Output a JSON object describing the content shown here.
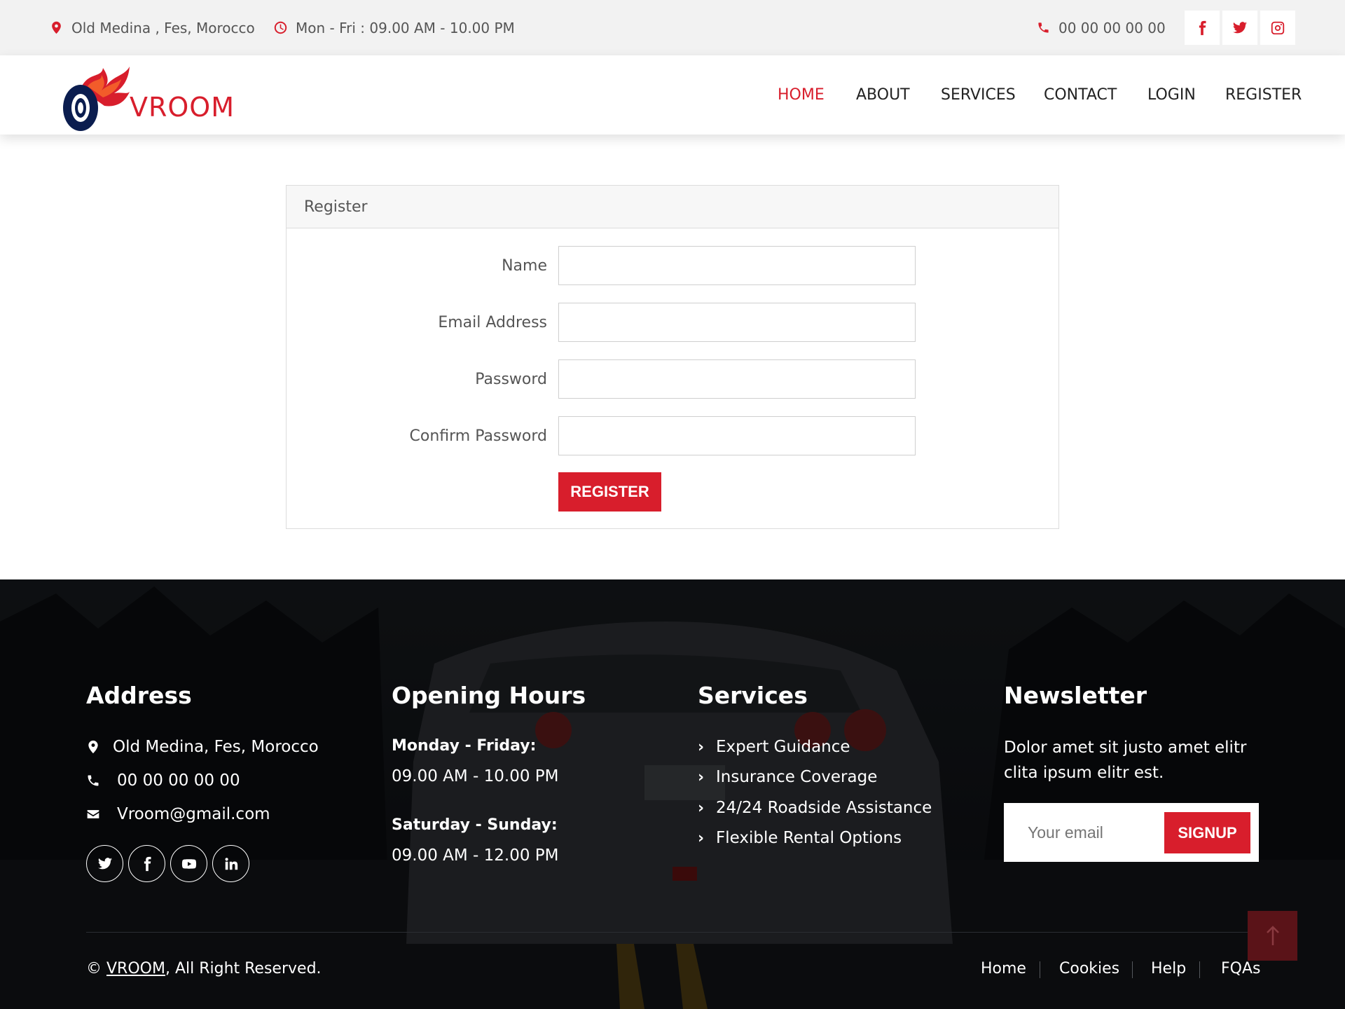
{
  "topbar": {
    "location": "Old Medina , Fes, Morocco",
    "hours": "Mon - Fri : 09.00 AM - 10.00 PM",
    "phone": "00 00 00 00 00",
    "social_icons": [
      "facebook-icon",
      "twitter-icon",
      "instagram-icon"
    ]
  },
  "brand": {
    "name": "VROOM",
    "accent_color": "#d81e2c",
    "dark_color": "#0b1d4f"
  },
  "nav": {
    "items": [
      {
        "label": "HOME",
        "active": true
      },
      {
        "label": "ABOUT",
        "active": false
      },
      {
        "label": "SERVICES",
        "active": false
      },
      {
        "label": "CONTACT",
        "active": false
      },
      {
        "label": "LOGIN",
        "active": false
      },
      {
        "label": "REGISTER",
        "active": false
      }
    ]
  },
  "register_form": {
    "title": "Register",
    "fields": [
      {
        "label": "Name",
        "value": ""
      },
      {
        "label": "Email Address",
        "value": ""
      },
      {
        "label": "Password",
        "value": ""
      },
      {
        "label": "Confirm Password",
        "value": ""
      }
    ],
    "submit_label": "REGISTER"
  },
  "footer": {
    "address": {
      "title": "Address",
      "location": "Old Medina, Fes, Morocco",
      "phone": "00 00 00 00 00",
      "email": "Vroom@gmail.com",
      "social_icons": [
        "twitter-icon",
        "facebook-icon",
        "youtube-icon",
        "linkedin-icon"
      ]
    },
    "opening_hours": {
      "title": "Opening Hours",
      "weekday_label": "Monday - Friday:",
      "weekday_hours": "09.00 AM - 10.00 PM",
      "weekend_label": "Saturday - Sunday:",
      "weekend_hours": "09.00 AM - 12.00 PM"
    },
    "services": {
      "title": "Services",
      "items": [
        "Expert Guidance",
        "Insurance Coverage",
        "24/24 Roadside Assistance",
        "Flexible Rental Options"
      ]
    },
    "newsletter": {
      "title": "Newsletter",
      "text": "Dolor amet sit justo amet elitr clita ipsum elitr est.",
      "placeholder": "Your email",
      "button_label": "SIGNUP"
    },
    "copyright": {
      "symbol": "©",
      "brand": "VROOM",
      "suffix": ", All Right Reserved."
    },
    "links": [
      "Home",
      "Cookies",
      "Help",
      "FQAs"
    ]
  }
}
